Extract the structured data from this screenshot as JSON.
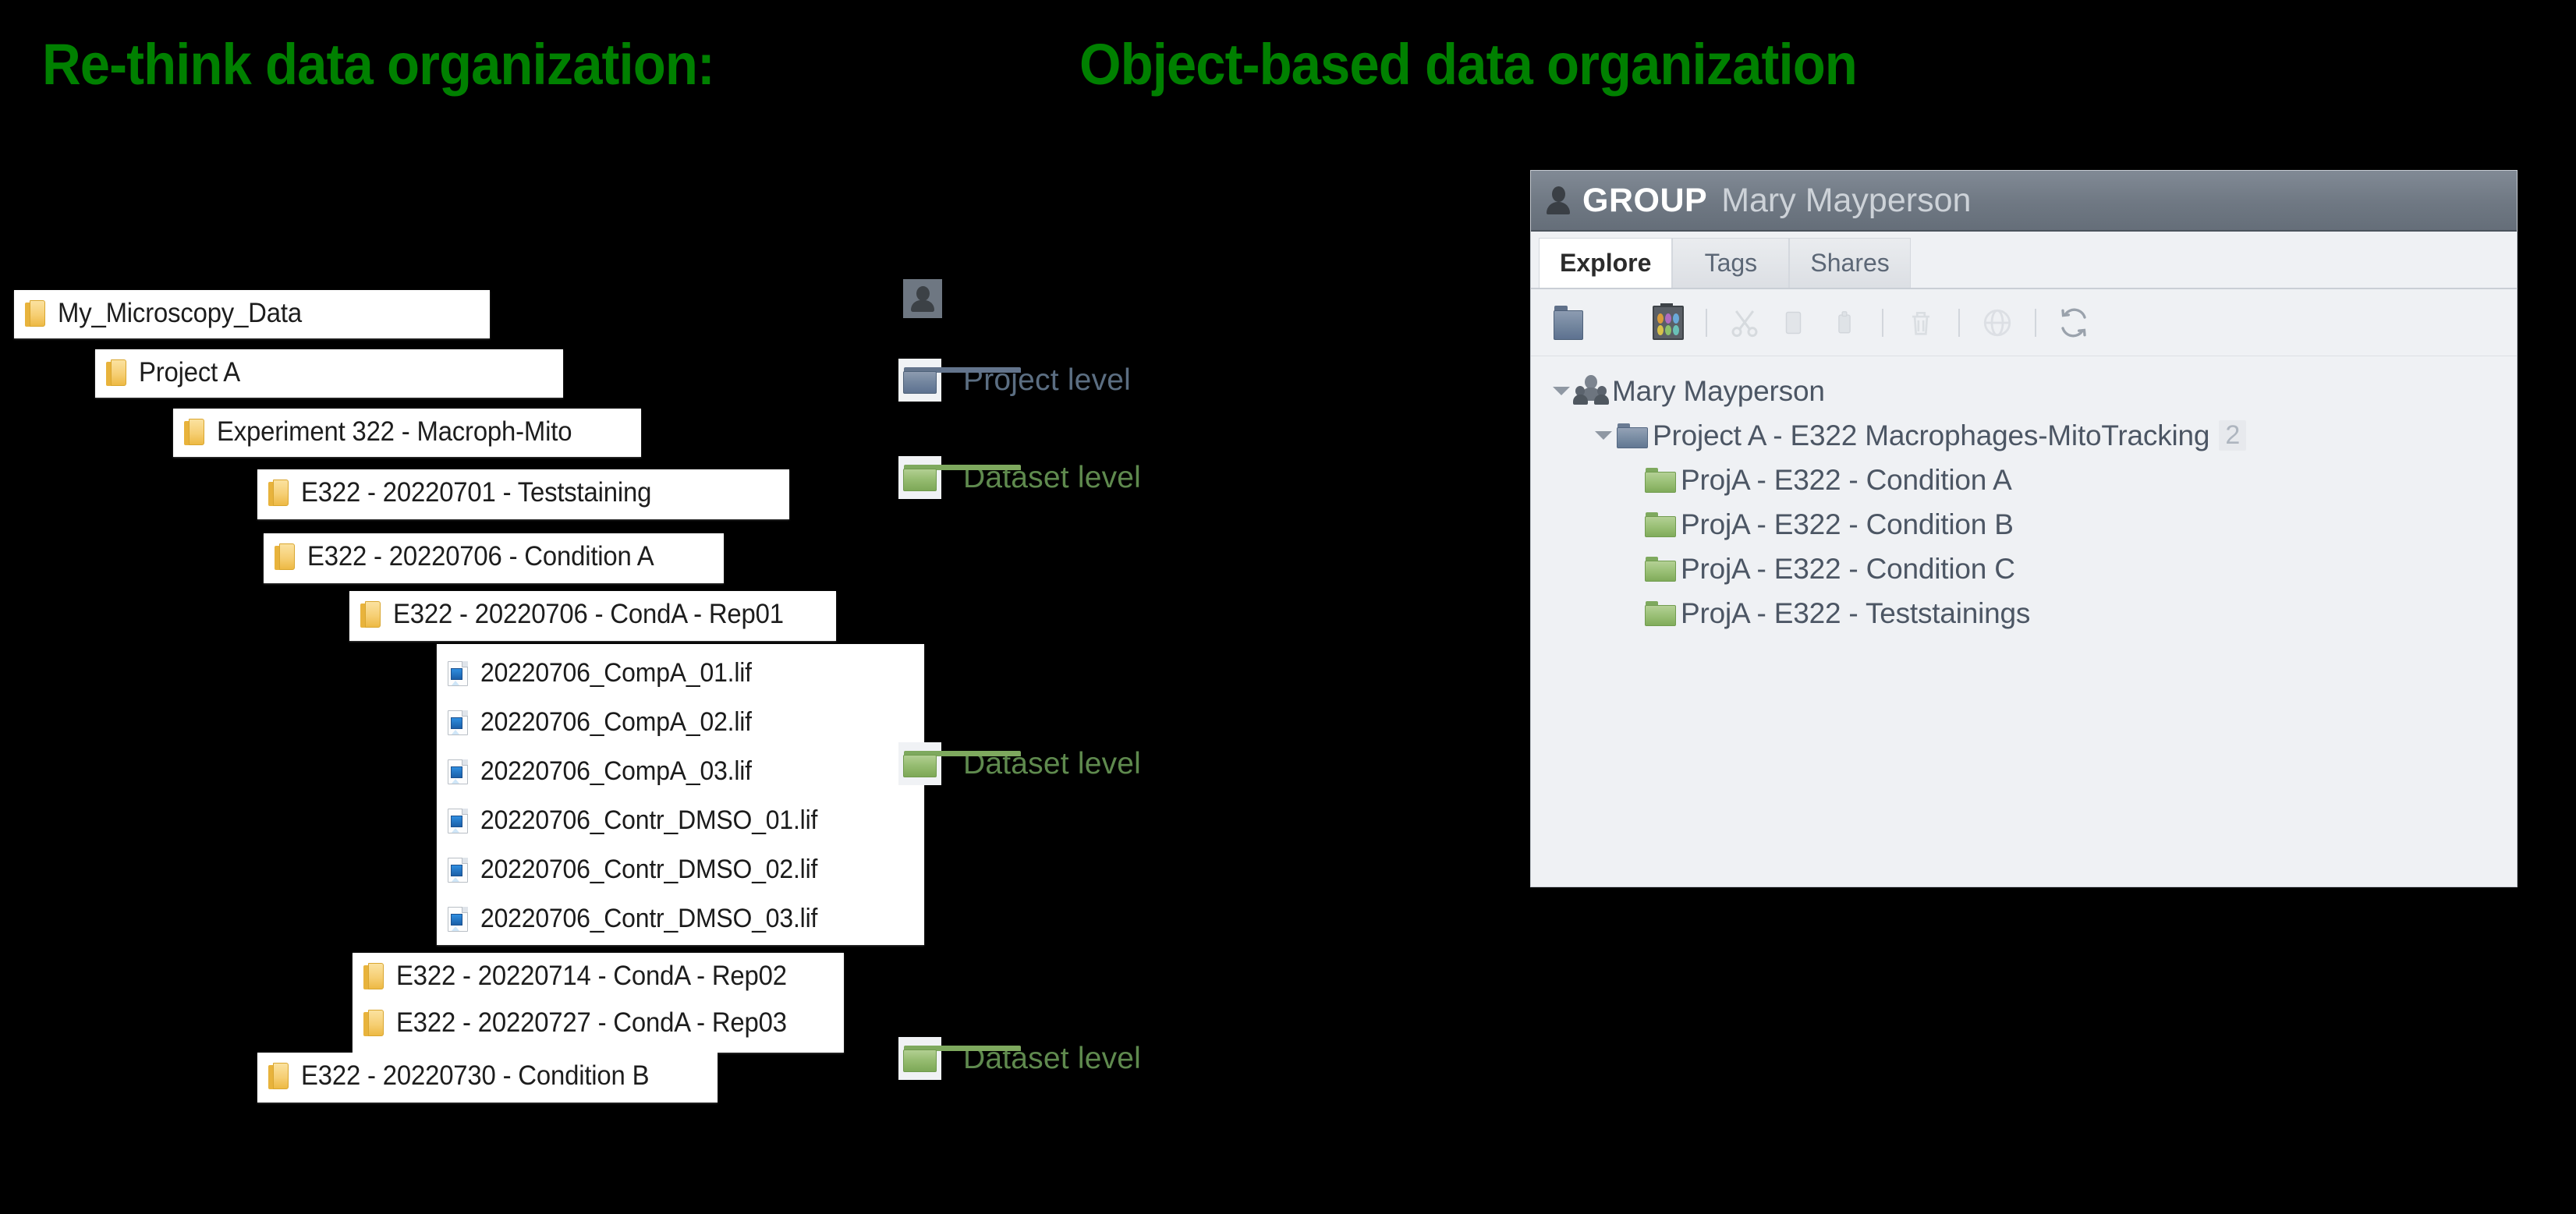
{
  "title": {
    "left": "Re-think data organization:",
    "right": "Object-based data organization",
    "color": "#008000"
  },
  "file_explorer": {
    "folders": [
      {
        "name": "My_Microscopy_Data"
      },
      {
        "name": "Project A"
      },
      {
        "name": "Experiment 322 - Macroph-Mito"
      },
      {
        "name": "E322 - 20220701 - Teststaining"
      },
      {
        "name": "E322 - 20220706 - Condition A"
      },
      {
        "name": "E322 - 20220706 - CondA - Rep01"
      }
    ],
    "files": [
      {
        "name": "20220706_CompA_01.lif"
      },
      {
        "name": "20220706_CompA_02.lif"
      },
      {
        "name": "20220706_CompA_03.lif"
      },
      {
        "name": "20220706_Contr_DMSO_01.lif"
      },
      {
        "name": "20220706_Contr_DMSO_02.lif"
      },
      {
        "name": "20220706_Contr_DMSO_03.lif"
      }
    ],
    "folders_bottom": [
      {
        "name": "E322 - 20220714 - CondA - Rep02"
      },
      {
        "name": "E322 - 20220727 - CondA - Rep03"
      },
      {
        "name": "E322 - 20220730 - Condition B"
      }
    ]
  },
  "legend": {
    "user_icon": "person-icon",
    "project": {
      "label": "Project level",
      "icon": "blue-folder-icon",
      "color": "#5b6e82"
    },
    "dataset1": {
      "label": "Dataset level",
      "icon": "green-folder-icon",
      "color": "#5f8a4e"
    },
    "dataset2": {
      "label": "Dataset level",
      "icon": "green-folder-icon",
      "color": "#5f8a4e"
    },
    "dataset3": {
      "label": "Dataset level",
      "icon": "green-folder-icon",
      "color": "#5f8a4e"
    }
  },
  "omero": {
    "header": {
      "group_label": "GROUP",
      "user_name": "Mary Mayperson"
    },
    "tabs": [
      {
        "label": "Explore",
        "active": true
      },
      {
        "label": "Tags",
        "active": false
      },
      {
        "label": "Shares",
        "active": false
      }
    ],
    "toolbar": [
      {
        "name": "new-project-folder-icon"
      },
      {
        "name": "new-screen-plate-icon"
      },
      {
        "name": "cut-icon"
      },
      {
        "name": "copy-icon"
      },
      {
        "name": "paste-icon"
      },
      {
        "name": "delete-trash-icon"
      },
      {
        "name": "publish-globe-icon"
      },
      {
        "name": "refresh-icon"
      }
    ],
    "tree": {
      "root": {
        "label": "Mary Mayperson",
        "icon": "group-users-icon",
        "expanded": true
      },
      "project": {
        "label": "Project A - E322 Macrophages-MitoTracking",
        "count": "2",
        "icon": "blue-folder-icon",
        "expanded": true
      },
      "datasets": [
        {
          "label": "ProjA - E322 - Condition A",
          "icon": "green-folder-icon"
        },
        {
          "label": "ProjA - E322 - Condition B",
          "icon": "green-folder-icon"
        },
        {
          "label": "ProjA - E322 - Condition C",
          "icon": "green-folder-icon"
        },
        {
          "label": "ProjA - E322 - Teststainings",
          "icon": "green-folder-icon"
        }
      ]
    }
  }
}
